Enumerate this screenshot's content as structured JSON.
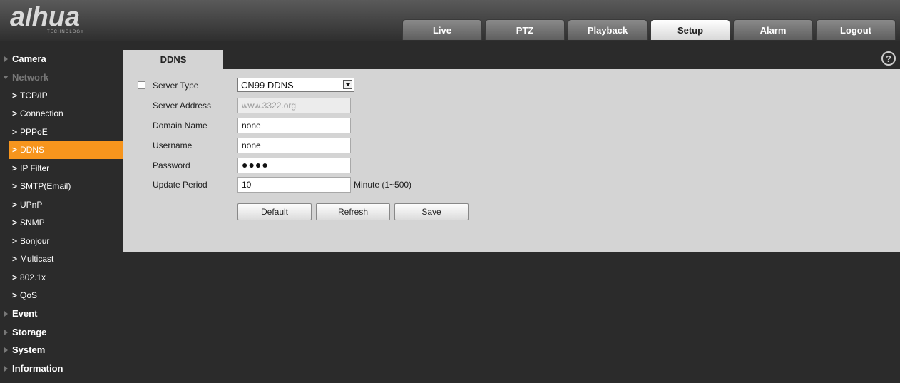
{
  "header": {
    "logo": "alhua",
    "logo_sub": "TECHNOLOGY",
    "tabs": [
      {
        "label": "Live"
      },
      {
        "label": "PTZ"
      },
      {
        "label": "Playback"
      },
      {
        "label": "Setup",
        "active": true
      },
      {
        "label": "Alarm"
      },
      {
        "label": "Logout"
      }
    ]
  },
  "sidebar": {
    "camera": "Camera",
    "network": "Network",
    "network_items": [
      "TCP/IP",
      "Connection",
      "PPPoE",
      "DDNS",
      "IP Filter",
      "SMTP(Email)",
      "UPnP",
      "SNMP",
      "Bonjour",
      "Multicast",
      "802.1x",
      "QoS"
    ],
    "active_item": "DDNS",
    "event": "Event",
    "storage": "Storage",
    "system": "System",
    "information": "Information"
  },
  "content": {
    "tab_label": "DDNS",
    "help_icon": "?",
    "form": {
      "server_type_label": "Server Type",
      "server_type_checked": false,
      "server_type_value": "CN99 DDNS",
      "server_address_label": "Server Address",
      "server_address_value": "www.3322.org",
      "domain_name_label": "Domain Name",
      "domain_name_value": "none",
      "username_label": "Username",
      "username_value": "none",
      "password_label": "Password",
      "password_value": "●●●●",
      "update_period_label": "Update Period",
      "update_period_value": "10",
      "update_period_unit": "Minute (1~500)"
    },
    "buttons": {
      "default": "Default",
      "refresh": "Refresh",
      "save": "Save"
    }
  },
  "colors": {
    "accent": "#f7951d",
    "background": "#2b2b2b",
    "panel": "#d4d4d4"
  }
}
